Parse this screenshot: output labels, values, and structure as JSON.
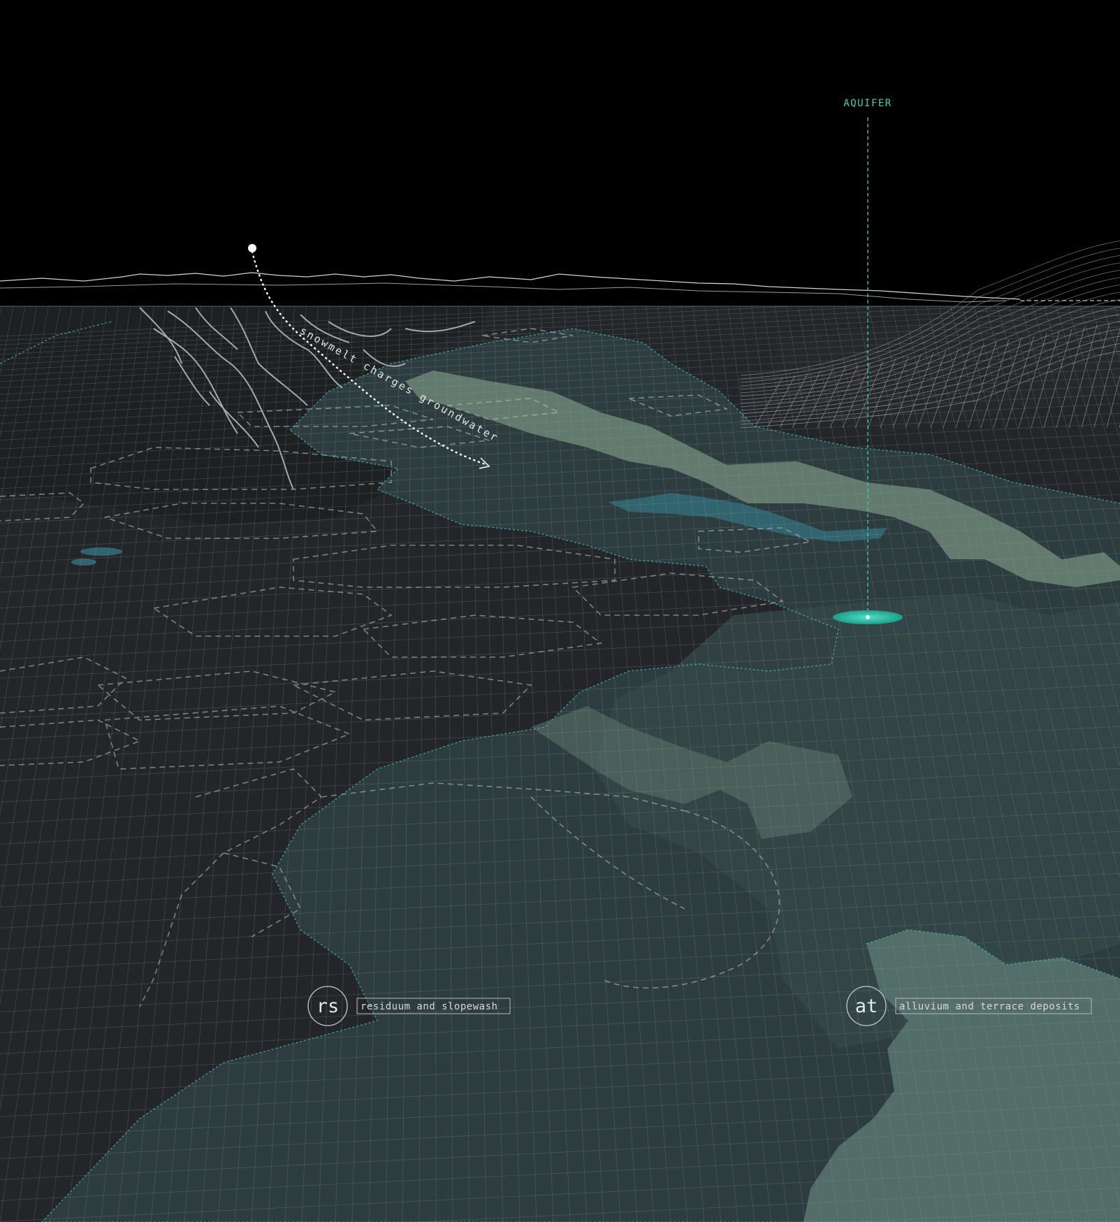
{
  "annotations": {
    "aquifer_label": "AQUIFER",
    "recharge_label": "snowmelt charges groundwater"
  },
  "legend": [
    {
      "code": "rs",
      "description": "residuum and slopewash"
    },
    {
      "code": "at",
      "description": "alluvium and terrace deposits"
    }
  ],
  "colors": {
    "sky": "#000000",
    "ground": "#1a1c1e",
    "aquifer_accent": "#3fc9b4",
    "deposit_teal": "#3b5a55",
    "alluvium_light": "#7f9a86",
    "line_light": "#c8c8c8"
  }
}
